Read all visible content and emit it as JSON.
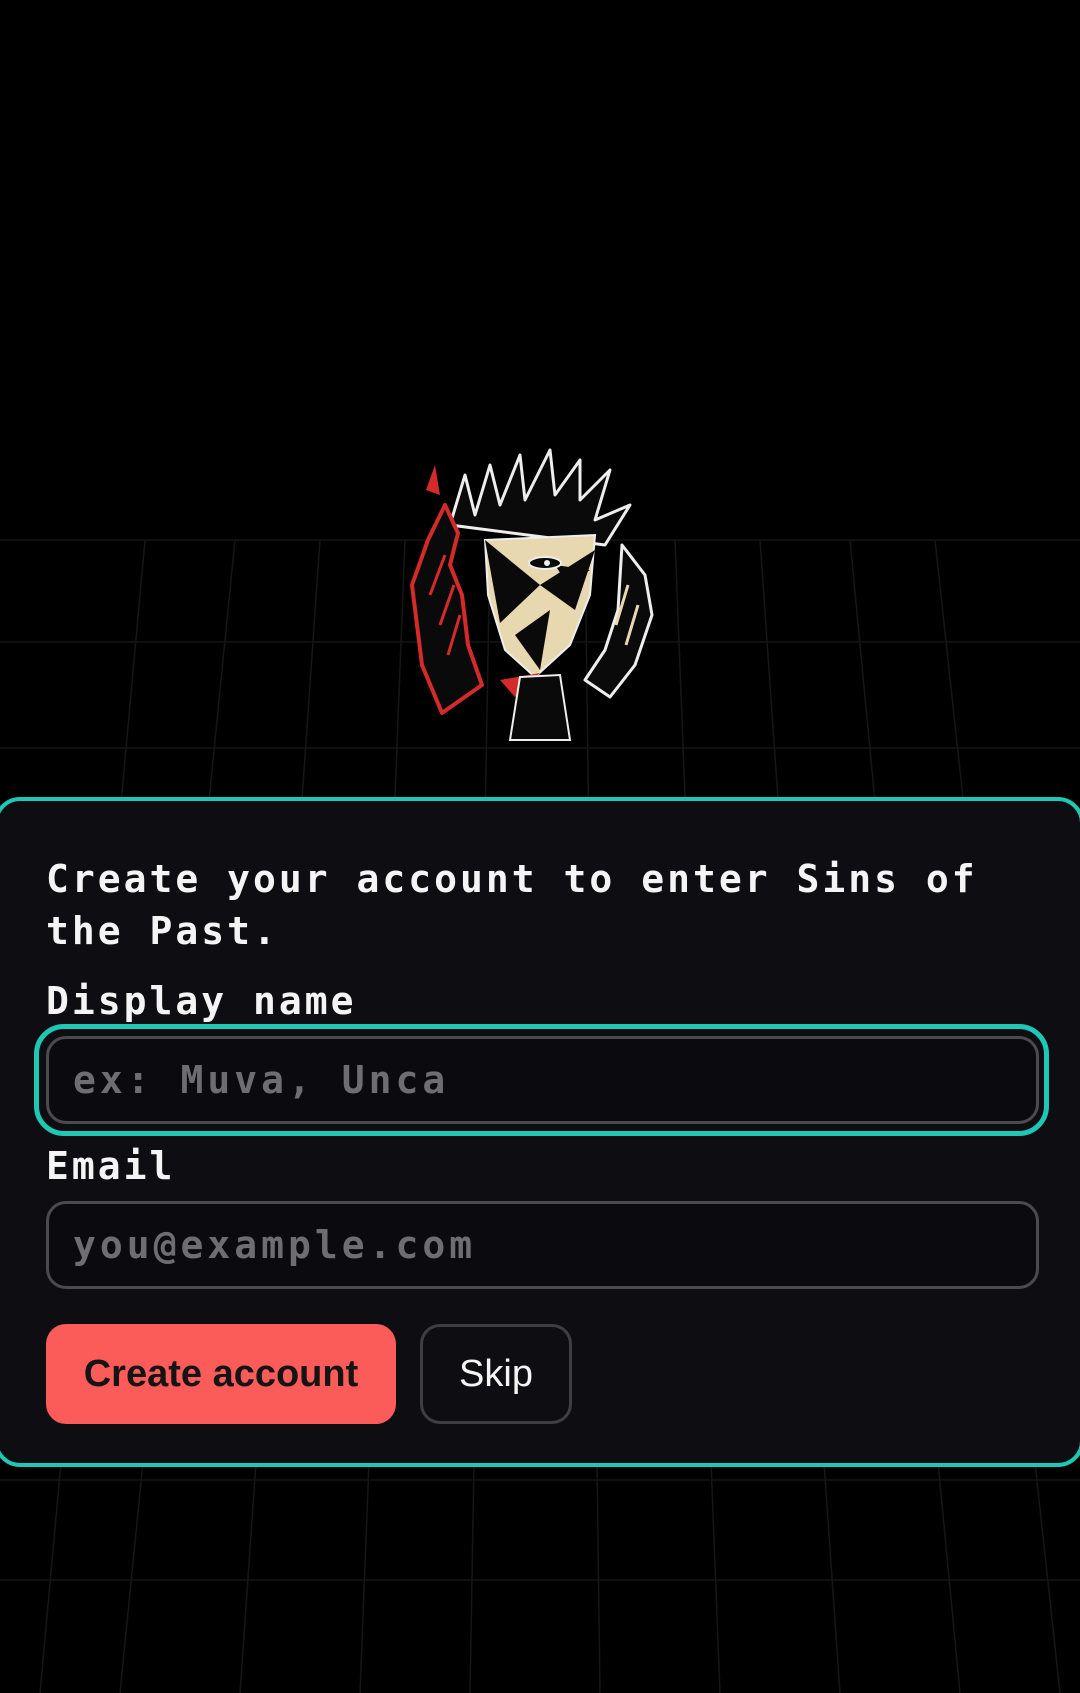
{
  "colors": {
    "background": "#000000",
    "card_background": "#0e0e12",
    "accent": "#1ec8b4",
    "primary_button": "#fb5c5a",
    "illustration_red": "#d42a2a",
    "illustration_skin": "#e8d8b0"
  },
  "illustration": {
    "icon": "anguished-face-illustration"
  },
  "signup": {
    "title": "Create your account to enter Sins of the Past.",
    "display_name": {
      "label": "Display name",
      "placeholder": "ex: Muva, Unca",
      "value": "",
      "focused": true
    },
    "email": {
      "label": "Email",
      "placeholder": "you@example.com",
      "value": ""
    },
    "create_button": "Create account",
    "skip_button": "Skip"
  }
}
